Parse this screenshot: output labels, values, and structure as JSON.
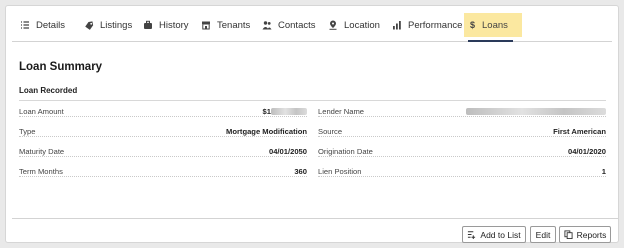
{
  "tabs": [
    {
      "label": "Details",
      "icon": "list-icon"
    },
    {
      "label": "Listings",
      "icon": "tag-icon"
    },
    {
      "label": "History",
      "icon": "briefcase-icon"
    },
    {
      "label": "Tenants",
      "icon": "storefront-icon"
    },
    {
      "label": "Contacts",
      "icon": "people-icon"
    },
    {
      "label": "Location",
      "icon": "map-pin-icon"
    },
    {
      "label": "Performance",
      "icon": "bar-chart-icon"
    },
    {
      "label": "Loans",
      "icon": "dollar-icon",
      "active": true
    }
  ],
  "section": {
    "title": "Loan Summary",
    "subtitle": "Loan Recorded"
  },
  "left_fields": [
    {
      "label": "Loan Amount",
      "value": "$1",
      "redacted": true
    },
    {
      "label": "Type",
      "value": "Mortgage Modification"
    },
    {
      "label": "Maturity Date",
      "value": "04/01/2050"
    },
    {
      "label": "Term Months",
      "value": "360"
    }
  ],
  "right_fields": [
    {
      "label": "Lender Name",
      "value": "",
      "redacted": true
    },
    {
      "label": "Source",
      "value": "First American"
    },
    {
      "label": "Origination Date",
      "value": "04/01/2020"
    },
    {
      "label": "Lien Position",
      "value": "1"
    }
  ],
  "buttons": {
    "add_to_list": "Add to List",
    "edit": "Edit",
    "reports": "Reports"
  },
  "colors": {
    "active_tab_bg": "#fbe8a0",
    "active_underline": "#2a3a5a"
  }
}
